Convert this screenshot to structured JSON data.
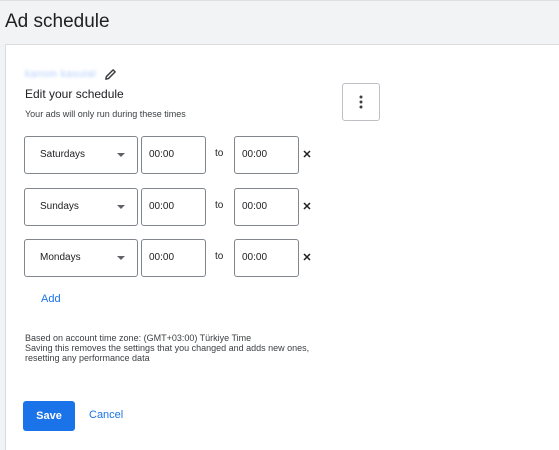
{
  "page": {
    "title": "Ad schedule"
  },
  "editor": {
    "campaign_name": "kanom kasutal",
    "heading": "Edit your schedule",
    "subtext": "Your ads will only run during these times",
    "to_label": "to"
  },
  "schedule": [
    {
      "day": "Saturdays",
      "start": "00:00",
      "end": "00:00"
    },
    {
      "day": "Sundays",
      "start": "00:00",
      "end": "00:00"
    },
    {
      "day": "Mondays",
      "start": "00:00",
      "end": "00:00"
    }
  ],
  "actions": {
    "add_label": "Add",
    "save_label": "Save",
    "cancel_label": "Cancel"
  },
  "notes": {
    "timezone": "Based on account time zone: (GMT+03:00) Türkiye Time",
    "warning": "Saving this removes the settings that you changed and adds new ones, resetting any performance data"
  },
  "colors": {
    "accent": "#1a73e8",
    "background": "#f1f3f4"
  },
  "icons": {
    "edit": "pencil-icon",
    "more": "kebab-icon",
    "remove": "close-icon",
    "dropdown": "caret-down-icon"
  }
}
